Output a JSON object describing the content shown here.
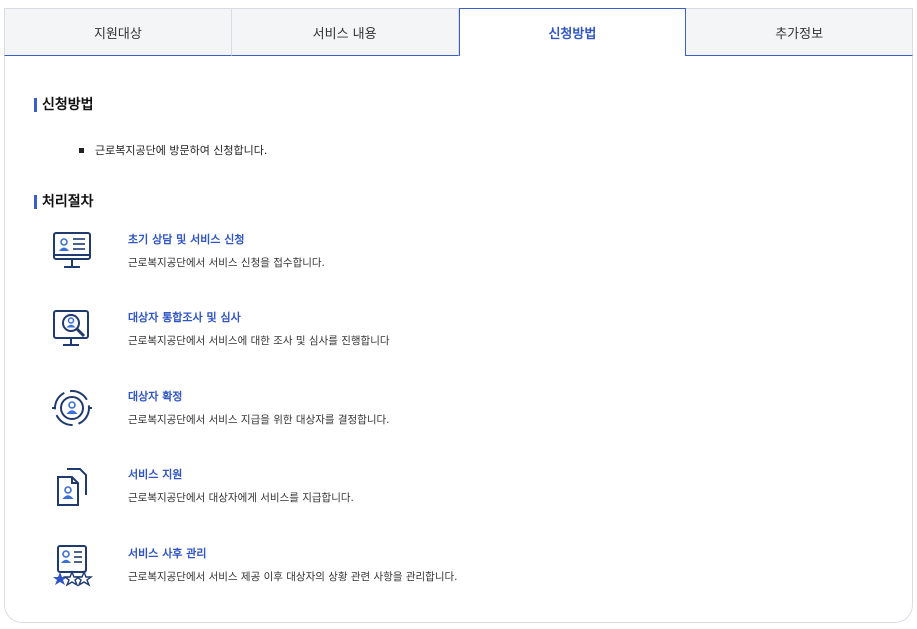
{
  "tabs": [
    {
      "label": "지원대상"
    },
    {
      "label": "서비스 내용"
    },
    {
      "label": "신청방법"
    },
    {
      "label": "추가정보"
    }
  ],
  "active_tab": "신청방법",
  "apply": {
    "title": "신청방법",
    "items": [
      "근로복지공단에 방문하여 신청합니다."
    ]
  },
  "process": {
    "title": "처리절차",
    "steps": [
      {
        "title": "초기 상담 및 서비스 신청",
        "desc": "근로복지공단에서 서비스 신청을 접수합니다.",
        "icon": "monitor-profile-icon"
      },
      {
        "title": "대상자 통합조사 및 심사",
        "desc": "근로복지공단에서 서비스에 대한 조사 및 심사를 진행합니다",
        "icon": "monitor-search-user-icon"
      },
      {
        "title": "대상자 확정",
        "desc": "근로복지공단에서 서비스 지급을 위한 대상자를 결정합니다.",
        "icon": "target-user-icon"
      },
      {
        "title": "서비스 지원",
        "desc": "근로복지공단에서 대상자에게 서비스를 지급합니다.",
        "icon": "documents-user-icon"
      },
      {
        "title": "서비스 사후 관리",
        "desc": "근로복지공단에서 서비스 제공 이후 대상자의 상황 관련 사항을 관리합니다.",
        "icon": "profile-rating-icon"
      }
    ]
  },
  "colors": {
    "accent": "#2f55c6",
    "icon_dark": "#1e3a6e",
    "icon_blue": "#3b6fd8"
  }
}
